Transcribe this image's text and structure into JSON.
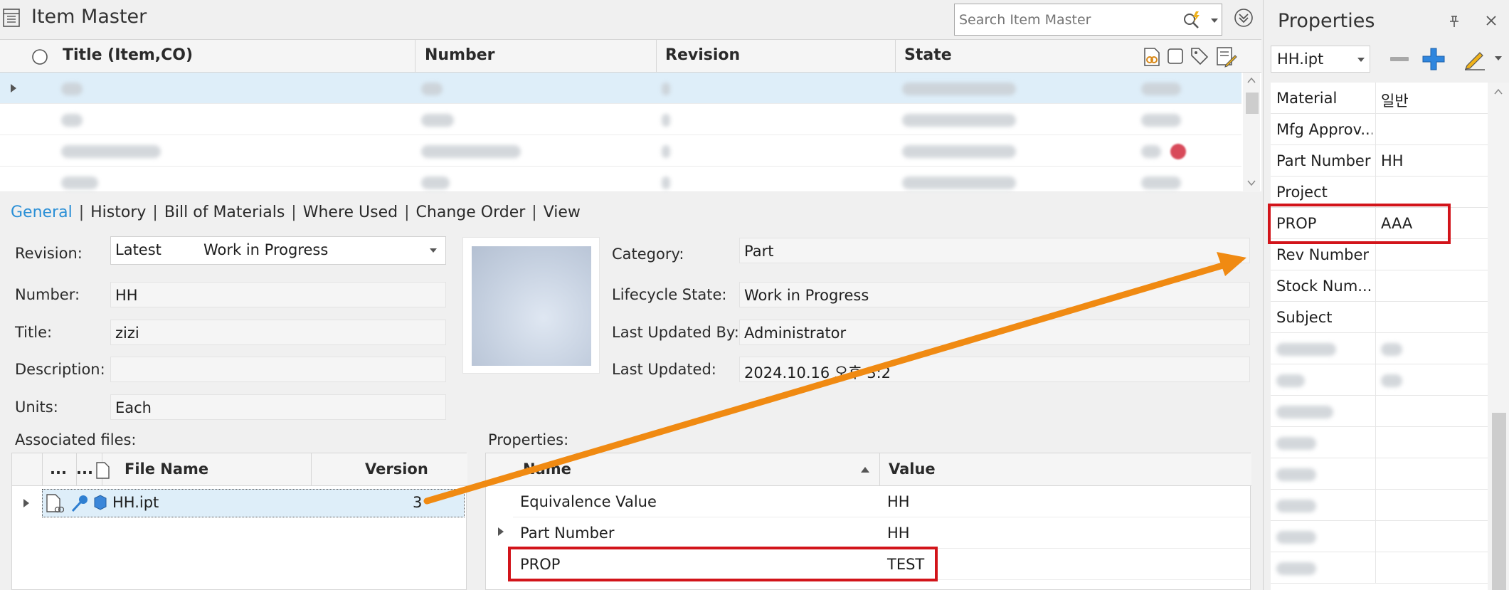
{
  "app": {
    "title": "Item Master"
  },
  "search": {
    "placeholder": "Search Item Master"
  },
  "grid": {
    "columns": [
      "Title (Item,CO)",
      "Number",
      "Revision",
      "State"
    ]
  },
  "tabs": [
    "General",
    "History",
    "Bill of Materials",
    "Where Used",
    "Change Order",
    "View"
  ],
  "general": {
    "revision_label": "Revision:",
    "revision_value": "Latest",
    "revision_state": "Work in Progress",
    "number_label": "Number:",
    "number_value": "HH",
    "title_label": "Title:",
    "title_value": "zizi",
    "description_label": "Description:",
    "description_value": "",
    "units_label": "Units:",
    "units_value": "Each",
    "category_label": "Category:",
    "category_value": "Part",
    "lifecycle_label": "Lifecycle State:",
    "lifecycle_value": "Work in Progress",
    "updated_by_label": "Last Updated By:",
    "updated_by_value": "Administrator",
    "updated_label": "Last Updated:",
    "updated_value": "2024.10.16 오후 3:2"
  },
  "files": {
    "label": "Associated files:",
    "columns": [
      "...",
      "...",
      "File Name",
      "Version"
    ],
    "rows": [
      {
        "name": "HH.ipt",
        "version": "3"
      }
    ]
  },
  "properties": {
    "label": "Properties:",
    "columns": [
      "Name",
      "Value"
    ],
    "rows": [
      {
        "name": "Equivalence Value",
        "value": "HH"
      },
      {
        "name": "Part Number",
        "value": "HH"
      },
      {
        "name": "PROP",
        "value": "TEST"
      }
    ]
  },
  "right_pane": {
    "title": "Properties",
    "file_select": "HH.ipt",
    "rows": [
      {
        "name": "Material",
        "value": "일반"
      },
      {
        "name": "Mfg Approv...",
        "value": ""
      },
      {
        "name": "Part Number",
        "value": "HH"
      },
      {
        "name": "Project",
        "value": ""
      },
      {
        "name": "PROP",
        "value": "AAA"
      },
      {
        "name": "Rev Number",
        "value": ""
      },
      {
        "name": "Stock Num...",
        "value": ""
      },
      {
        "name": "Subject",
        "value": ""
      }
    ]
  },
  "colors": {
    "accent": "#2a8fd6",
    "highlight_box": "#d2141a",
    "arrow": "#f08a12",
    "selection": "#deeef9"
  }
}
